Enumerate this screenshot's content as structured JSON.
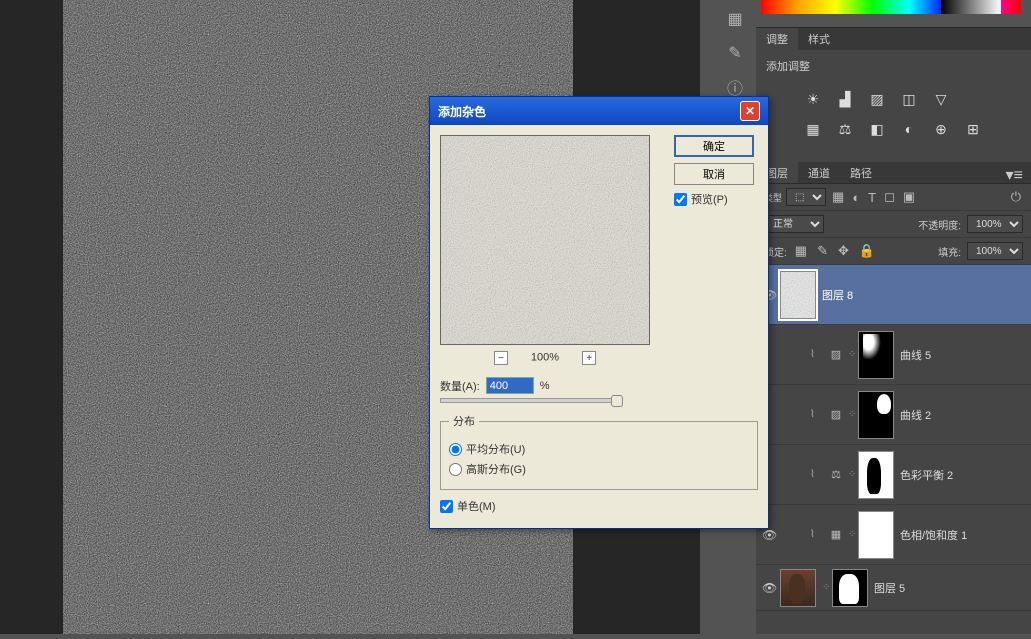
{
  "dialog": {
    "title": "添加杂色",
    "ok": "确定",
    "cancel": "取消",
    "preview": "预览(P)",
    "zoom": "100%",
    "amount_label": "数量(A):",
    "amount_value": "400",
    "amount_unit": "%",
    "dist_legend": "分布",
    "dist_uniform": "平均分布(U)",
    "dist_gaussian": "高斯分布(G)",
    "mono": "单色(M)"
  },
  "adjust": {
    "tab_adjust": "调整",
    "tab_style": "样式",
    "add_adjust": "添加调整"
  },
  "layers": {
    "tab_layer": "图层",
    "tab_channel": "通道",
    "tab_path": "路径",
    "kind_label": "类型",
    "blend": "正常",
    "opacity_label": "不透明度:",
    "opacity_value": "100%",
    "lock_label": "锁定:",
    "fill_label": "填充:",
    "fill_value": "100%",
    "items": [
      {
        "name": "图层 8"
      },
      {
        "name": "曲线 5"
      },
      {
        "name": "曲线 2"
      },
      {
        "name": "色彩平衡 2"
      },
      {
        "name": "色相/饱和度 1"
      },
      {
        "name": "图层 5"
      }
    ]
  }
}
